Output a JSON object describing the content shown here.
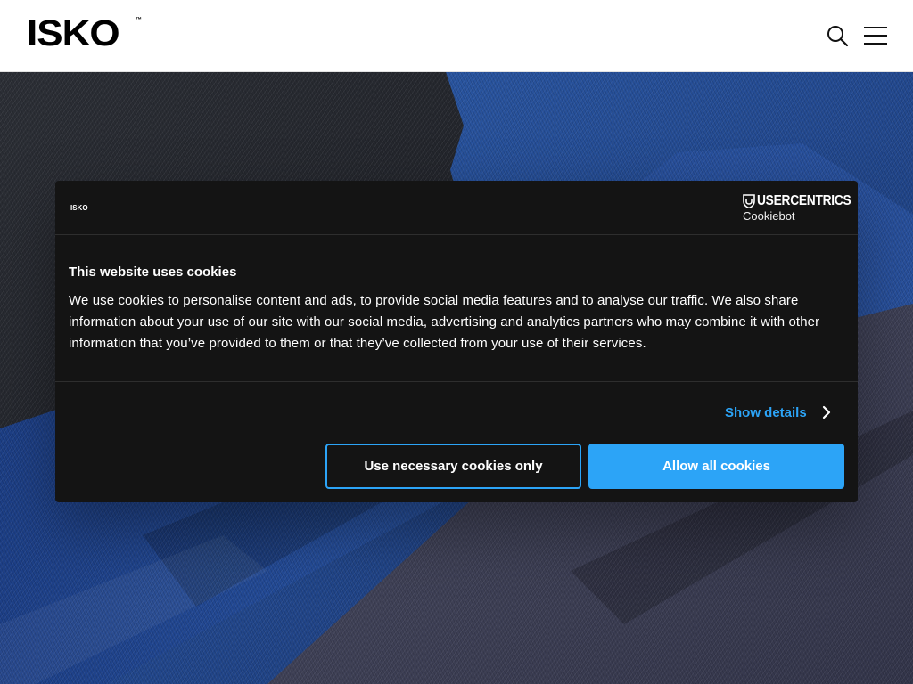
{
  "header": {
    "logo_text": "ISKO",
    "logo_tm": "™",
    "search_icon": "search-icon",
    "menu_icon": "hamburger-menu-icon"
  },
  "cookie_dialog": {
    "logo_text": "ISKO",
    "provider": {
      "name": "USERCENTRICS",
      "sub": "Cookiebot",
      "icon": "usercentrics-shield-icon"
    },
    "title": "This website uses cookies",
    "body": "We use cookies to personalise content and ads, to provide social media features and to analyse our traffic. We also share information about your use of our site with our social media, advertising and analytics partners who may combine it with other information that you’ve provided to them or that they’ve collected from your use of their services.",
    "show_details_label": "Show details",
    "show_details_icon": "chevron-right-icon",
    "necessary_button_label": "Use necessary cookies only",
    "allow_button_label": "Allow all cookies"
  },
  "colors": {
    "accent": "#2ca4f7",
    "dialog_bg": "#141414",
    "header_bg": "#ffffff"
  }
}
